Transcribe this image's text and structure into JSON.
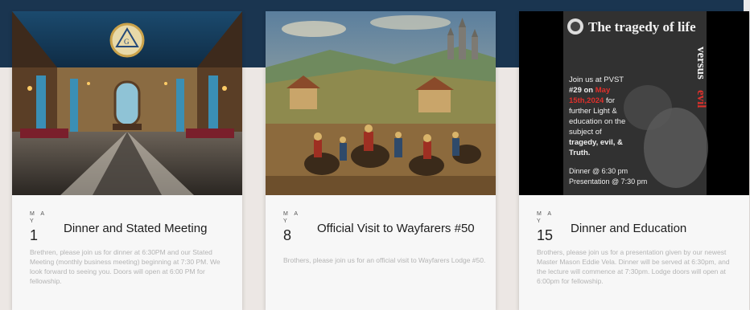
{
  "events": [
    {
      "month": "M A Y",
      "day": "1",
      "title": "Dinner and Stated Meeting",
      "description": "Brethren, please join us for dinner at 6:30PM and our Stated Meeting (monthly business meeting) beginning at 7:30 PM. We look forward to seeing you. Doors will open at 6:00 PM for fellowship.",
      "image_label": "masonic-lodge-room-image"
    },
    {
      "month": "M A Y",
      "day": "8",
      "title": "Official Visit to Wayfarers #50",
      "description": "Brothers, please join us for an official visit to Wayfarers Lodge #50.",
      "image_label": "medieval-procession-image"
    },
    {
      "month": "M A Y",
      "day": "15",
      "title": "Dinner and Education",
      "description": "Brothers, please join us for a presentation given by our newest Master Mason Eddie Vela. Dinner will be served at 6:30pm, and the lecture will commence at 7:30pm. Lodge doors will open at 6:00pm for fellowship.",
      "image_label": "tragedy-of-life-poster-image"
    }
  ],
  "poster": {
    "title": "The tragedy of life",
    "versus": "versus",
    "evil": "evil",
    "line1": "Join us at PVST",
    "line2a": "#29 on ",
    "line2b": "May",
    "line3a": "15th,2024",
    "line3b": " for",
    "line4": "further Light &",
    "line5": "education on the",
    "line6": "subject of",
    "line7": "tragedy, evil, &",
    "line8": "Truth.",
    "line9": "Dinner @ 6:30 pm",
    "line10": "Presentation @ 7:30 pm"
  },
  "colors": {
    "header_band": "#1a3550",
    "page_background": "#ece7e4",
    "card_background": "#f7f7f7",
    "poster_red": "#e0302b"
  }
}
